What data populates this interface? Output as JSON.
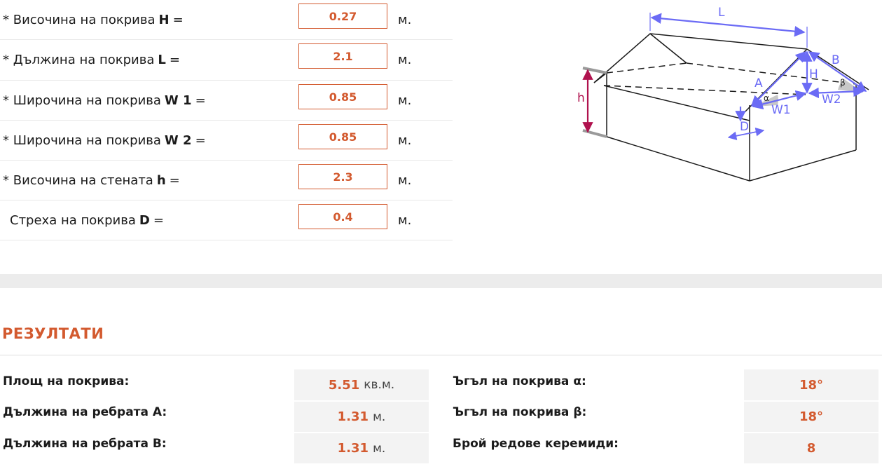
{
  "inputs": [
    {
      "label": "Височина на покрива",
      "var": "H",
      "eq": "=",
      "required": true,
      "value": "0.27",
      "unit": "м."
    },
    {
      "label": "Дължина на покрива",
      "var": "L",
      "eq": "=",
      "required": true,
      "value": "2.1",
      "unit": "м."
    },
    {
      "label": "Широчина на покрива",
      "var": "W 1",
      "eq": "=",
      "required": true,
      "value": "0.85",
      "unit": "м."
    },
    {
      "label": "Широчина на покрива",
      "var": "W 2",
      "eq": "=",
      "required": true,
      "value": "0.85",
      "unit": "м."
    },
    {
      "label": "Височина на стената",
      "var": "h",
      "eq": "=",
      "required": true,
      "value": "2.3",
      "unit": "м."
    },
    {
      "label": "Стреха на покрива",
      "var": "D",
      "eq": "=",
      "required": false,
      "value": "0.4",
      "unit": "м."
    }
  ],
  "required_mark": "*",
  "diagram": {
    "labels": {
      "L": "L",
      "B": "B",
      "A": "A",
      "H": "H",
      "h": "h",
      "W1": "W1",
      "W2": "W2",
      "D": "D",
      "alpha": "α",
      "beta": "β"
    },
    "colors": {
      "dimension": "#6b6bf5",
      "wall_height": "#b0124e",
      "edge": "#1a1a1a",
      "angle_fill": "#c8c8c8"
    }
  },
  "results": {
    "title": "РЕЗУЛТАТИ",
    "left": [
      {
        "label": "Площ на покрива:",
        "value": "5.51",
        "unit": "кв.м."
      },
      {
        "label": "Дължина на ребрата A:",
        "value": "1.31",
        "unit": "м."
      },
      {
        "label": "Дължина на ребрата B:",
        "value": "1.31",
        "unit": "м."
      }
    ],
    "right": [
      {
        "label": "Ъгъл на покрива α:",
        "value": "18°",
        "unit": ""
      },
      {
        "label": "Ъгъл на покрива β:",
        "value": "18°",
        "unit": ""
      },
      {
        "label": "Брой редове керемиди:",
        "value": "8",
        "unit": ""
      }
    ]
  },
  "colors": {
    "accent": "#d35a2f",
    "result_bg": "#f3f3f3",
    "band": "#ececec"
  }
}
